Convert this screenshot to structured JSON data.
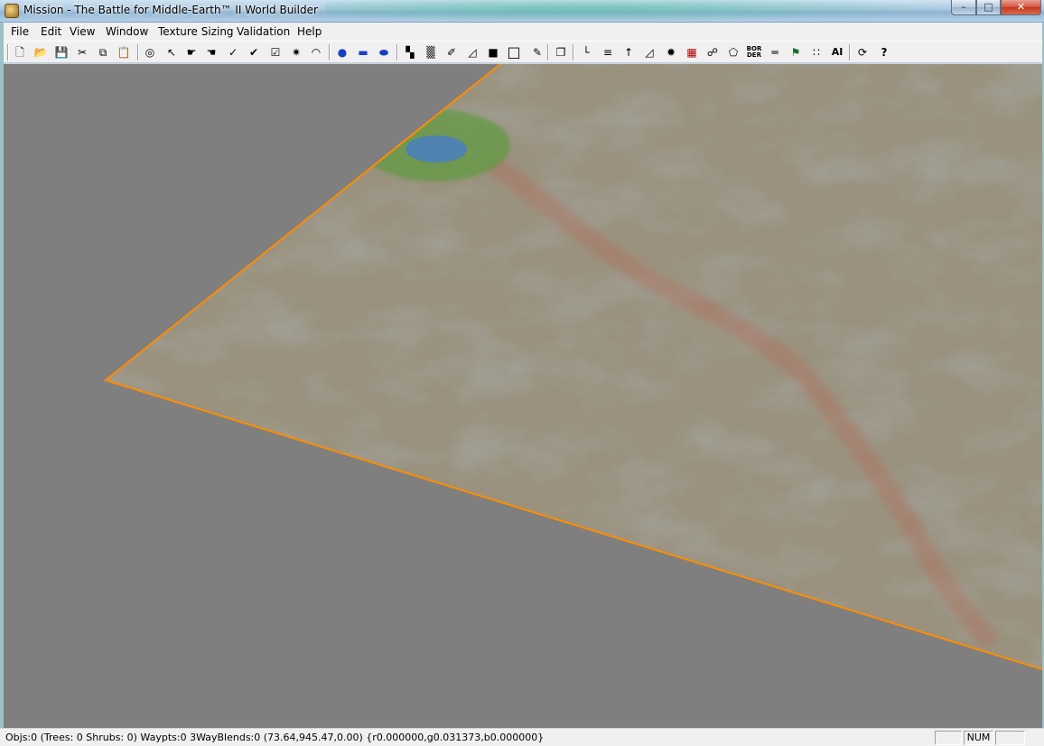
{
  "window": {
    "title": "Mission - The Battle for Middle-Earth™ II World Builder",
    "minimize_symbol": "–",
    "maximize_symbol": "□",
    "close_symbol": "✕"
  },
  "menu": [
    "File",
    "Edit",
    "View",
    "Window",
    "Texture Sizing",
    "Validation",
    "Help"
  ],
  "toolbar": {
    "icons": [
      {
        "name": "new-file-icon",
        "glyph": "🗋"
      },
      {
        "name": "open-folder-icon",
        "glyph": "📂"
      },
      {
        "name": "save-icon",
        "glyph": "💾"
      },
      {
        "name": "cut-icon",
        "glyph": "✂"
      },
      {
        "name": "copy-icon",
        "glyph": "⧉"
      },
      {
        "name": "paste-icon",
        "glyph": "📋"
      },
      {
        "name": "select-area-icon",
        "glyph": "◎"
      },
      {
        "name": "pointer-icon",
        "glyph": "↖"
      },
      {
        "name": "move-tool-icon",
        "glyph": "☛"
      },
      {
        "name": "rotate-tool-icon",
        "glyph": "☚"
      },
      {
        "name": "brush-icon",
        "glyph": "✓"
      },
      {
        "name": "brush-add-icon",
        "glyph": "✔"
      },
      {
        "name": "brush-smooth-icon",
        "glyph": "☑"
      },
      {
        "name": "feather-icon",
        "glyph": "✷"
      },
      {
        "name": "terrain-raise-icon",
        "glyph": "◠"
      },
      {
        "name": "water-icon",
        "glyph": "●"
      },
      {
        "name": "water-area-icon",
        "glyph": "▬"
      },
      {
        "name": "water-fill-icon",
        "glyph": "⬬"
      },
      {
        "name": "tile-paint-icon",
        "glyph": "▚"
      },
      {
        "name": "texture-grid-icon",
        "glyph": "▒"
      },
      {
        "name": "eyedropper-icon",
        "glyph": "✐"
      },
      {
        "name": "fill-bucket-icon",
        "glyph": "◿"
      },
      {
        "name": "black-square-icon",
        "glyph": "■"
      },
      {
        "name": "outline-square-icon",
        "glyph": "□"
      },
      {
        "name": "pen-edit-icon",
        "glyph": "✎"
      },
      {
        "name": "copy-paste-objects-icon",
        "glyph": "❐"
      },
      {
        "name": "axis-icon",
        "glyph": "└"
      },
      {
        "name": "contour-icon",
        "glyph": "≡"
      },
      {
        "name": "tree-icon",
        "glyph": "↑"
      },
      {
        "name": "ramp-icon",
        "glyph": "◿"
      },
      {
        "name": "blob-icon",
        "glyph": "✹"
      },
      {
        "name": "build-grid-icon",
        "glyph": "▦"
      },
      {
        "name": "waypoint-icon",
        "glyph": "☍"
      },
      {
        "name": "polygon-icon",
        "glyph": "⬠"
      },
      {
        "name": "border-icon",
        "glyph": "BOR DER"
      },
      {
        "name": "road-icon",
        "glyph": "═"
      },
      {
        "name": "team-icon",
        "glyph": "⚑"
      },
      {
        "name": "scripts-icon",
        "glyph": "∷"
      },
      {
        "name": "ai-icon",
        "glyph": "AI"
      },
      {
        "name": "timer-icon",
        "glyph": "⟳"
      },
      {
        "name": "help-icon",
        "glyph": "?"
      }
    ]
  },
  "colors": {
    "map_border": "#ff8c00",
    "viewport_bg": "#7f7f7f",
    "terrain_base": "#8a8270",
    "grass_patch": "#6aa04a",
    "water_pool": "#4a7fbf",
    "road_trail": "#b07060"
  },
  "status": {
    "text": "Objs:0 (Trees: 0 Shrubs: 0) Waypts:0 3WayBlends:0 (73.64,945.47,0.00) {r0.000000,g0.031373,b0.000000}",
    "pane1": "",
    "pane2": "NUM",
    "pane3": ""
  }
}
